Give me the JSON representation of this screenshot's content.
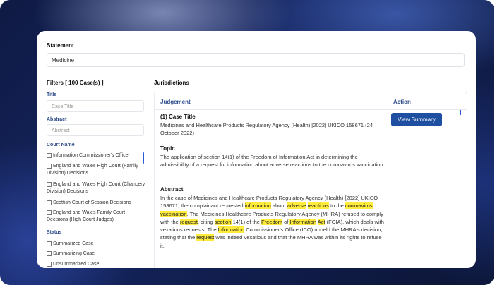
{
  "statement": {
    "label": "Statement",
    "value": "Medicine"
  },
  "filters": {
    "heading": "Filters [ 100 Case(s) ]",
    "title": {
      "label": "Title",
      "placeholder": "Case Title"
    },
    "abstract": {
      "label": "Abstract",
      "placeholder": "Abstract"
    },
    "court_name": {
      "label": "Court Name",
      "options": [
        "Information Commissioner's Office",
        "England and Wales High Court (Family Division) Decisions",
        "England and Wales High Court (Chancery Division) Decisions",
        "Scottish Court of Session Decisions",
        "England and Wales Family Court Decisions (High Court Judges)"
      ]
    },
    "status": {
      "label": "Status",
      "options": [
        "Summarized Case",
        "Summarizing Case",
        "Unsummarized Case"
      ]
    }
  },
  "jurisdictions": {
    "label": "Jurisdictions",
    "columns": [
      "Judgement",
      "Action"
    ],
    "row": {
      "case_title_label": "(1) Case Title",
      "case_title": "Medicines and Healthcare Products Regulatory Agency (Health) [2022] UKICO 158671 (24 October 2022)",
      "topic_label": "Topic",
      "topic": "The application of section 14(1) of the Freedom of Information Act in determining the admissibility of a request for information about adverse reactions to the coronavirus vaccination.",
      "abstract_label": "Abstract",
      "abstract": "In the case of Medicines and Healthcare Products Regulatory Agency (Health) [2022] UKICO 158671, the complainant requested information about adverse reactions to the coronavirus vaccination. The Medicines Healthcare Products Regulatory Agency (MHRA) refused to comply with the request, citing section 14(1) of the Freedom of Information Act (FOIA), which deals with vexatious requests. The Information Commissioner's Office (ICO) upheld the MHRA's decision, stating that the request was indeed vexatious and that the MHRA was within its rights to refuse it.",
      "highlight_terms": [
        "information",
        "adverse",
        "reactions",
        "coronavirus",
        "vaccination",
        "request",
        "section",
        "Freedom",
        "Information",
        "Act",
        "Information",
        "request"
      ],
      "action_label": "View Summary"
    }
  },
  "colors": {
    "accent": "#1f4fa0",
    "highlight": "#ffeb3b",
    "heading_blue": "#2a4a8a"
  }
}
